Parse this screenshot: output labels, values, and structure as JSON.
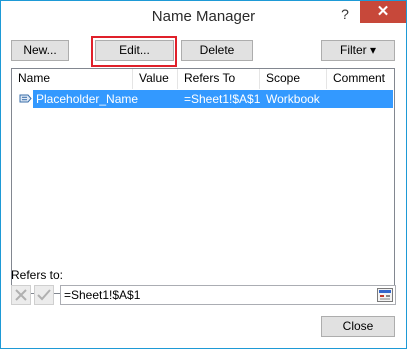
{
  "window": {
    "title": "Name Manager",
    "help": "?",
    "close_glyph": "✕"
  },
  "toolbar": {
    "new_label": "New...",
    "edit_label": "Edit...",
    "delete_label": "Delete",
    "filter_label": "Filter ▾"
  },
  "columns": [
    "Name",
    "Value",
    "Refers To",
    "Scope",
    "Comment"
  ],
  "rows": [
    {
      "name": "Placeholder_Name",
      "value": "",
      "refers_to": "=Sheet1!$A$1",
      "scope": "Workbook",
      "comment": ""
    }
  ],
  "refers_to": {
    "label": "Refers to:",
    "value": "=Sheet1!$A$1"
  },
  "footer": {
    "close_label": "Close"
  },
  "icons": {
    "cancel": "x-icon",
    "confirm": "checkmark-icon",
    "collapse": "collapse-dialog-icon",
    "name": "name-tag-icon"
  },
  "colors": {
    "selection": "#3399ff",
    "highlight": "#e0202a",
    "close_bg": "#c7483a",
    "border": "#1e9ad6"
  }
}
